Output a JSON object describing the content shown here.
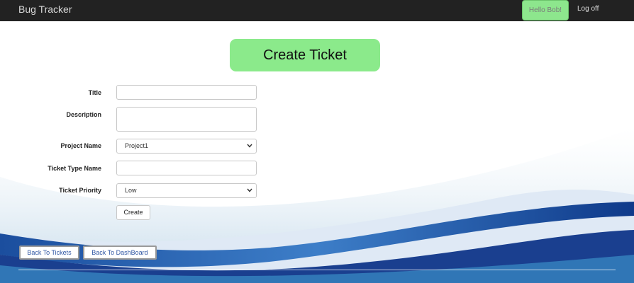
{
  "navbar": {
    "brand": "Bug Tracker",
    "greeting": "Hello Bob!",
    "logoff": "Log off"
  },
  "page": {
    "heading": "Create Ticket"
  },
  "form": {
    "title_label": "Title",
    "title_value": "",
    "description_label": "Description",
    "description_value": "",
    "project_label": "Project Name",
    "project_value": "Project1",
    "ticket_type_label": "Ticket Type Name",
    "ticket_type_value": "",
    "priority_label": "Ticket Priority",
    "priority_value": "Low",
    "create_button": "Create"
  },
  "footer_links": {
    "back_to_tickets": "Back To Tickets",
    "back_to_dashboard": "Back To DashBoard"
  },
  "colors": {
    "navbar": "#222222",
    "accent_green": "#8bea8b",
    "link_blue": "#2e55a3"
  },
  "icons": {
    "select": "chevron-down-icon"
  }
}
